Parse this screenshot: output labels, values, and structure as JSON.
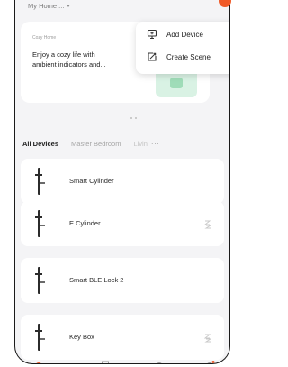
{
  "header": {
    "home_label": "My Home ...",
    "icons": {
      "add": "plus-circle-icon",
      "caret": "chevron-down-icon"
    },
    "accent_color": "#f05a28"
  },
  "banner": {
    "tag": "Cozy Home",
    "text": "Enjoy a cozy life with ambient indicators and...",
    "icon": "lamp-illustration"
  },
  "menu": {
    "items": [
      {
        "label": "Add Device",
        "icon": "add-device-icon"
      },
      {
        "label": "Create Scene",
        "icon": "create-scene-icon"
      }
    ]
  },
  "tabs": {
    "items": [
      {
        "label": "All Devices",
        "active": true
      },
      {
        "label": "Master Bedroom",
        "active": false
      },
      {
        "label": "Livin",
        "active": false
      }
    ],
    "more_icon": "more-horizontal-icon"
  },
  "devices": [
    {
      "name": "Smart Cylinder",
      "status_icon": ""
    },
    {
      "name": "E Cylinder",
      "status_icon": "sleep-icon"
    },
    {
      "name": "Smart BLE Lock 2",
      "status_icon": ""
    },
    {
      "name": "Key Box",
      "status_icon": "sleep-icon"
    }
  ],
  "bottom_nav": {
    "icons": [
      "home-icon",
      "scene-icon",
      "smart-icon",
      "profile-icon"
    ]
  }
}
